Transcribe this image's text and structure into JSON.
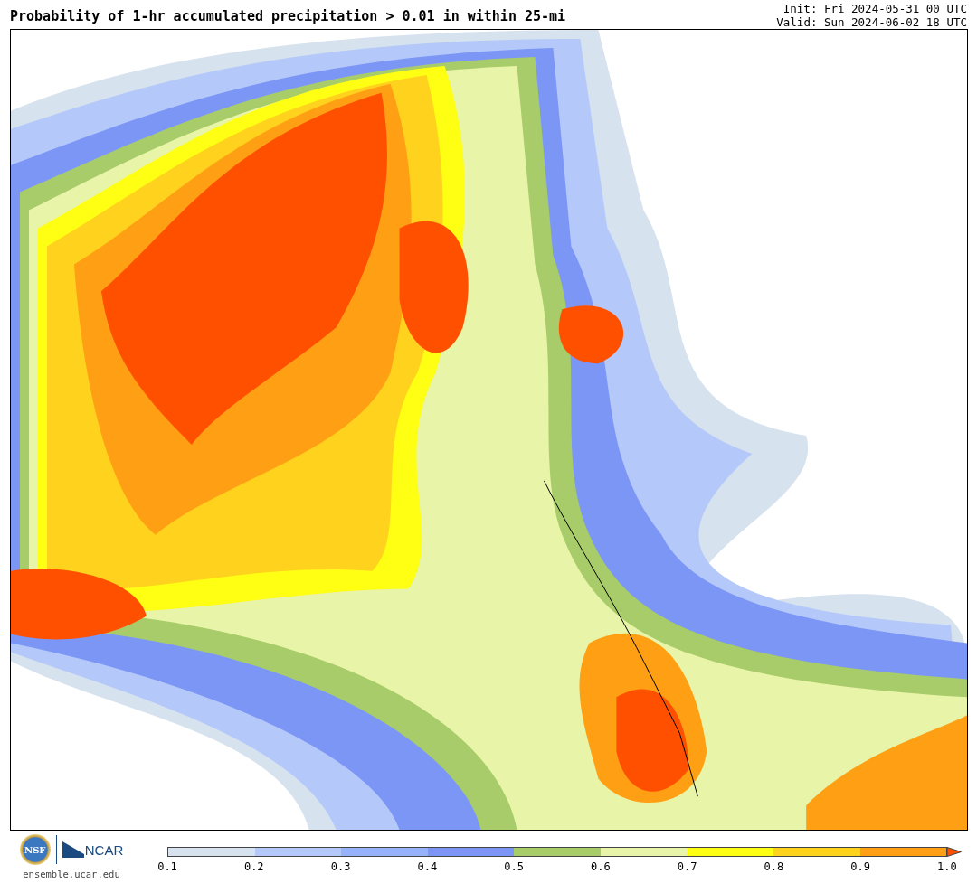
{
  "title": "Probability of 1-hr accumulated precipitation > 0.01 in within 25-mi",
  "init": "Init: Fri 2024-05-31 00 UTC",
  "valid": "Valid: Sun 2024-06-02 18 UTC",
  "logos": {
    "nsf": "NSF",
    "ncar": "NCAR",
    "site": "ensemble.ucar.edu"
  },
  "colorbar": {
    "bins": [
      {
        "color": "#d6e2ee"
      },
      {
        "color": "#b4c8fa"
      },
      {
        "color": "#96b2fa"
      },
      {
        "color": "#7c96f5"
      },
      {
        "color": "#a8cc6a"
      },
      {
        "color": "#e8f4a8"
      },
      {
        "color": "#ffff14"
      },
      {
        "color": "#ffd21e"
      },
      {
        "color": "#ffa014"
      }
    ],
    "ticks": [
      "0.1",
      "0.2",
      "0.3",
      "0.4",
      "0.5",
      "0.6",
      "0.7",
      "0.8",
      "0.9",
      "1.0"
    ]
  }
}
